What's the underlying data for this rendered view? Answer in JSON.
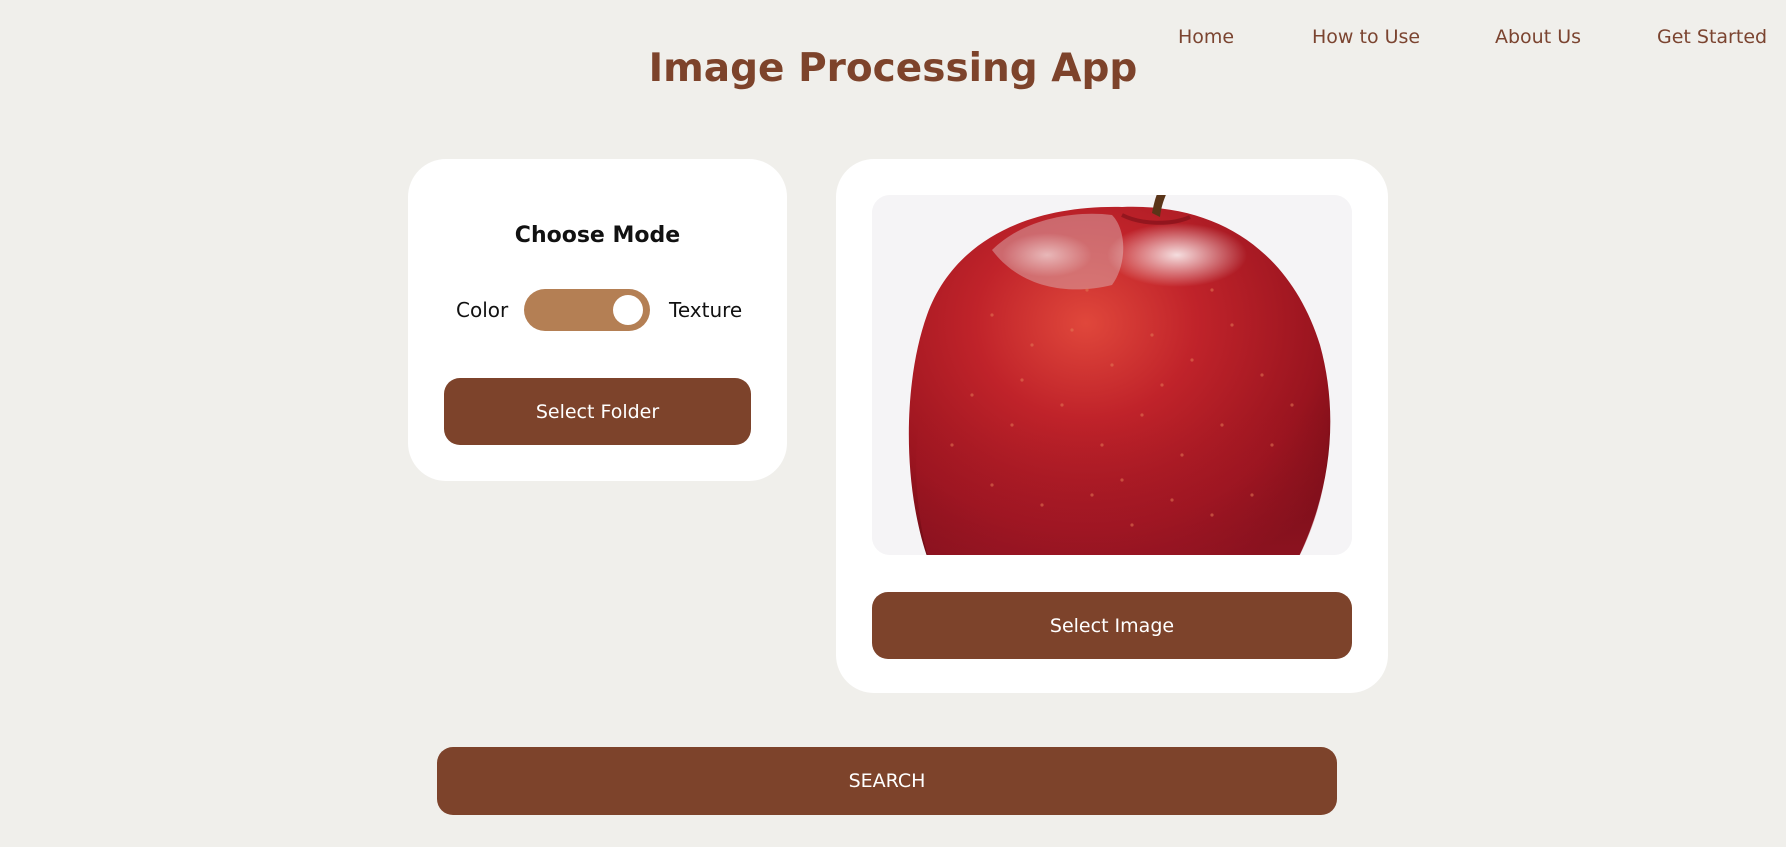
{
  "nav": {
    "items": [
      "Home",
      "How to Use",
      "About Us",
      "Get Started"
    ]
  },
  "header": {
    "title": "Image Processing App"
  },
  "mode_card": {
    "title": "Choose Mode",
    "left_label": "Color",
    "right_label": "Texture",
    "toggle_state": "Texture",
    "select_folder_label": "Select Folder"
  },
  "image_card": {
    "image_subject": "red apple",
    "select_image_label": "Select Image"
  },
  "search": {
    "label": "SEARCH"
  },
  "colors": {
    "background": "#f0efeb",
    "brand": "#7d432b",
    "toggle": "#b47f54",
    "card": "#ffffff"
  }
}
